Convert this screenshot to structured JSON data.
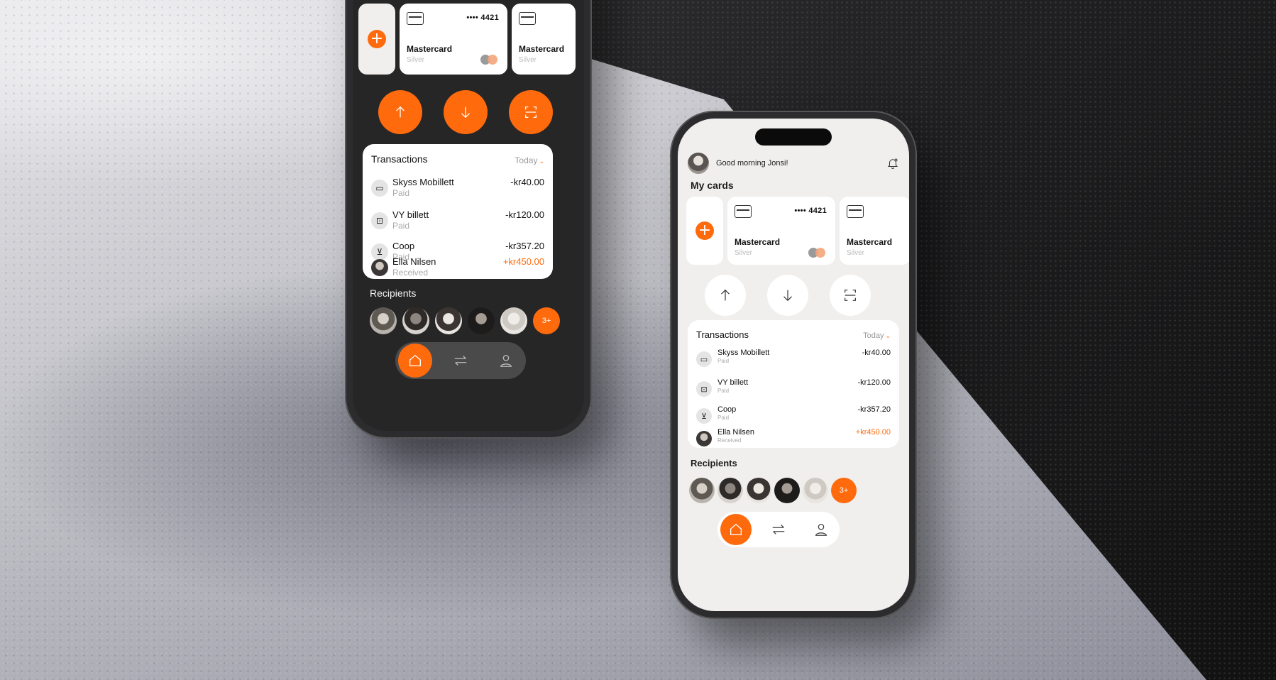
{
  "colors": {
    "accent": "#ff6a0d",
    "dark_bg": "#262627",
    "light_bg": "#f0efed"
  },
  "light_phone": {
    "greeting": "Good morning Jonsi!",
    "my_cards_title": "My cards"
  },
  "cards": [
    {
      "number": "•••• 4421",
      "name": "Mastercard",
      "tier": "Silver"
    },
    {
      "number": "",
      "name": "Mastercard",
      "tier": "Silver"
    }
  ],
  "icons": {
    "add": "plus-icon",
    "send": "arrow-up-icon",
    "receive": "arrow-down-icon",
    "scan": "scan-icon",
    "home": "home-icon",
    "transfer": "transfer-icon",
    "profile": "profile-icon",
    "notifications": "bell-icon"
  },
  "transactions": {
    "title": "Transactions",
    "filter": "Today",
    "items": [
      {
        "name": "Skyss Mobillett",
        "status": "Paid",
        "amount": "-kr40.00",
        "icon": "bus-icon"
      },
      {
        "name": "VY billett",
        "status": "Paid",
        "amount": "-kr120.00",
        "icon": "train-icon"
      },
      {
        "name": "Coop",
        "status": "Paid",
        "amount": "-kr357.20",
        "icon": "cart-icon"
      },
      {
        "name": "Ella Nilsen",
        "status": "Received",
        "amount": "+kr450.00",
        "icon": "person-avatar"
      }
    ]
  },
  "recipients": {
    "title": "Recipients",
    "more_label": "3+"
  }
}
